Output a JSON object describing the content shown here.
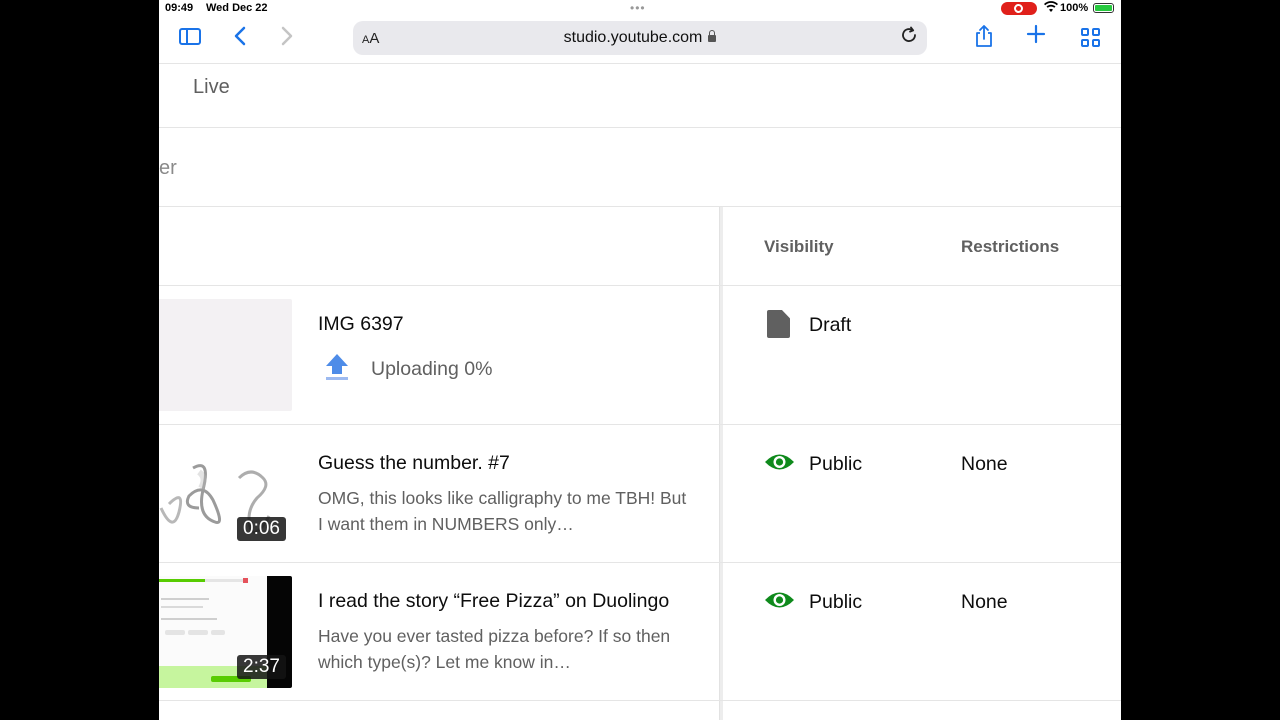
{
  "status_bar": {
    "time": "09:49",
    "date": "Wed Dec 22",
    "battery": "100%"
  },
  "browser": {
    "url": "studio.youtube.com",
    "text_size_label": "AA"
  },
  "page": {
    "tab_label": "Live",
    "filter_fragment": "er",
    "columns": {
      "visibility": "Visibility",
      "restrictions": "Restrictions"
    },
    "rows": [
      {
        "title": "IMG 6397",
        "status": "Uploading 0%",
        "visibility": "Draft",
        "visibility_icon": "draft-document-icon",
        "restrictions": ""
      },
      {
        "title": "Guess the number. #7",
        "description": "OMG, this looks like calligraphy to me TBH! But I want them in NUMBERS only…",
        "duration": "0:06",
        "visibility": "Public",
        "visibility_icon": "eye-icon",
        "restrictions": "None"
      },
      {
        "title": "I read the story “Free Pizza” on Duolingo",
        "description": "Have you ever tasted pizza before? If so then which type(s)? Let me know in…",
        "duration": "2:37",
        "visibility": "Public",
        "visibility_icon": "eye-icon",
        "restrictions": "None"
      }
    ]
  },
  "colors": {
    "public_green": "#0f8a1c",
    "browser_accent": "#1a73e8",
    "record_red": "#e0201b"
  }
}
